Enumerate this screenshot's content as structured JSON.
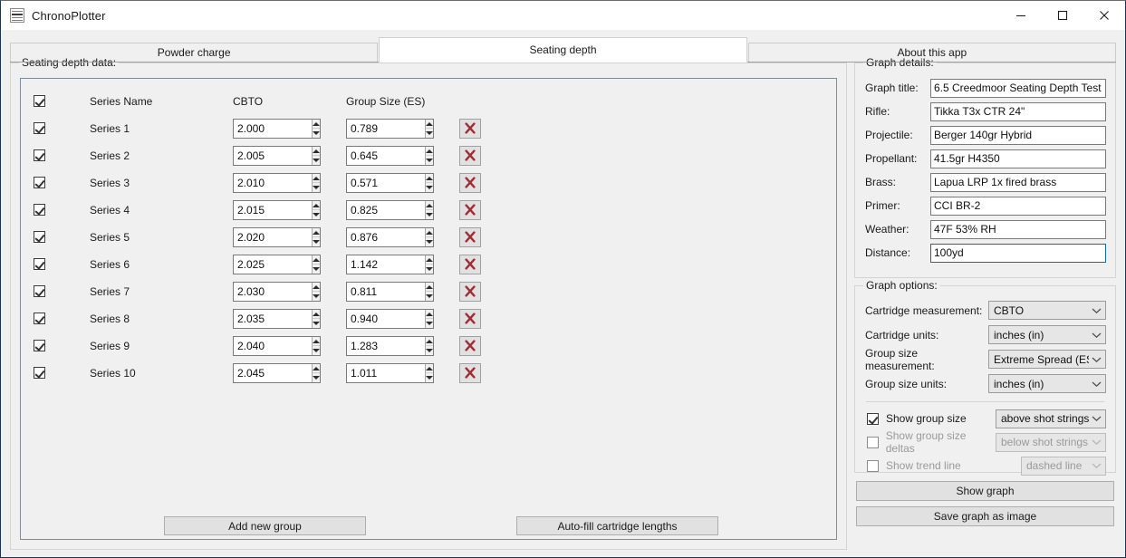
{
  "window": {
    "title": "ChronoPlotter",
    "icon": "app-document-icon",
    "controls": {
      "minimize": "–",
      "maximize": "□",
      "close": "✕"
    }
  },
  "tabs": [
    {
      "label": "Powder charge",
      "active": false
    },
    {
      "label": "Seating depth",
      "active": true
    },
    {
      "label": "About this app",
      "active": false
    }
  ],
  "left_panel": {
    "group_label": "Seating depth data:",
    "columns": {
      "select_all": true,
      "name": "Series Name",
      "cbto": "CBTO",
      "group_size": "Group Size (ES)"
    },
    "rows": [
      {
        "checked": true,
        "name": "Series 1",
        "cbto": "2.000",
        "group_size": "0.789"
      },
      {
        "checked": true,
        "name": "Series 2",
        "cbto": "2.005",
        "group_size": "0.645"
      },
      {
        "checked": true,
        "name": "Series 3",
        "cbto": "2.010",
        "group_size": "0.571"
      },
      {
        "checked": true,
        "name": "Series 4",
        "cbto": "2.015",
        "group_size": "0.825"
      },
      {
        "checked": true,
        "name": "Series 5",
        "cbto": "2.020",
        "group_size": "0.876"
      },
      {
        "checked": true,
        "name": "Series 6",
        "cbto": "2.025",
        "group_size": "1.142"
      },
      {
        "checked": true,
        "name": "Series 7",
        "cbto": "2.030",
        "group_size": "0.811"
      },
      {
        "checked": true,
        "name": "Series 8",
        "cbto": "2.035",
        "group_size": "0.940"
      },
      {
        "checked": true,
        "name": "Series 9",
        "cbto": "2.040",
        "group_size": "1.283"
      },
      {
        "checked": true,
        "name": "Series 10",
        "cbto": "2.045",
        "group_size": "1.011"
      }
    ],
    "delete_icon": "delete-x-icon",
    "buttons": {
      "add_group": "Add new group",
      "autofill": "Auto-fill cartridge lengths"
    }
  },
  "graph_details": {
    "group_label": "Graph details:",
    "fields": [
      {
        "label": "Graph title:",
        "value": "6.5 Creedmoor Seating Depth Test",
        "focused": false
      },
      {
        "label": "Rifle:",
        "value": "Tikka T3x CTR 24\"",
        "focused": false
      },
      {
        "label": "Projectile:",
        "value": "Berger 140gr Hybrid",
        "focused": false
      },
      {
        "label": "Propellant:",
        "value": "41.5gr H4350",
        "focused": false
      },
      {
        "label": "Brass:",
        "value": "Lapua LRP 1x fired brass",
        "focused": false
      },
      {
        "label": "Primer:",
        "value": "CCI BR-2",
        "focused": false
      },
      {
        "label": "Weather:",
        "value": "47F 53% RH",
        "focused": false
      },
      {
        "label": "Distance:",
        "value": "100yd",
        "focused": true
      }
    ]
  },
  "graph_options": {
    "group_label": "Graph options:",
    "selects": [
      {
        "label": "Cartridge measurement:",
        "value": "CBTO",
        "width": 130,
        "disabled": false
      },
      {
        "label": "Cartridge units:",
        "value": "inches (in)",
        "width": 130,
        "disabled": false
      },
      {
        "label": "Group size measurement:",
        "value": "Extreme Spread (ES)",
        "width": 130,
        "disabled": false
      },
      {
        "label": "Group size units:",
        "value": "inches (in)",
        "width": 130,
        "disabled": false
      }
    ],
    "toggles": [
      {
        "label": "Show group size",
        "checked": true,
        "disabled": false,
        "select_value": "above shot strings",
        "select_width": 122,
        "select_disabled": false
      },
      {
        "label": "Show group size deltas",
        "checked": false,
        "disabled": true,
        "select_value": "below shot strings",
        "select_width": 122,
        "select_disabled": true
      },
      {
        "label": "Show trend line",
        "checked": false,
        "disabled": true,
        "select_value": "dashed line",
        "select_width": 94,
        "select_disabled": true
      }
    ],
    "buttons": {
      "show_graph": "Show graph",
      "save_graph": "Save graph as image"
    }
  },
  "colors": {
    "window_bg": "#f0f0f0",
    "accent_focus": "#0f6cbd",
    "delete_x": "#a02c35",
    "panel_border": "#7f8c9b",
    "frame": "#1c3453"
  }
}
